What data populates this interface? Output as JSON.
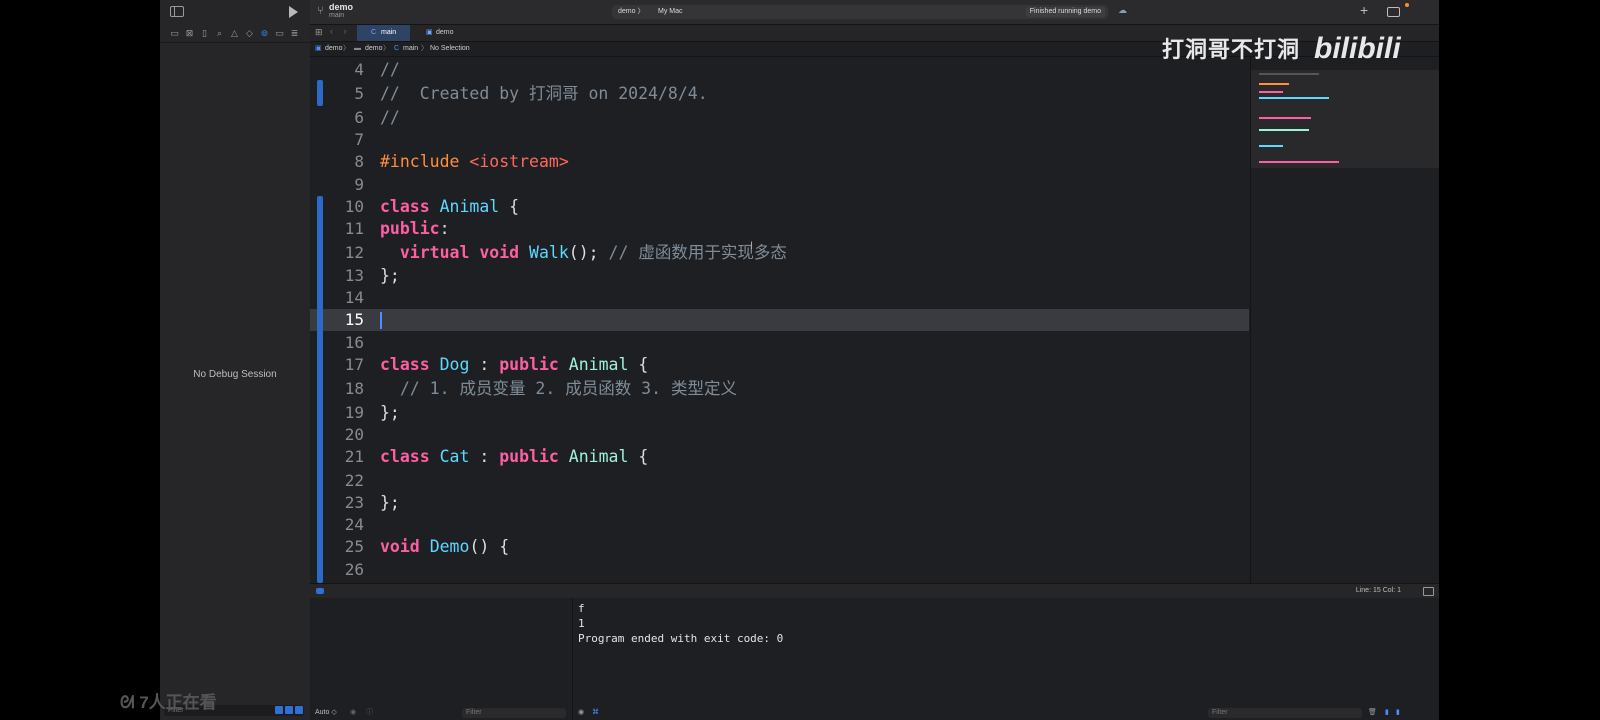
{
  "toolbar": {
    "project_name": "demo",
    "branch": "main",
    "scheme_target": "demo 〉",
    "run_destination": "My Mac",
    "status": "Finished running demo",
    "add_label": "+"
  },
  "tabs": [
    {
      "label": "main",
      "active": true
    },
    {
      "label": "demo",
      "active": false
    }
  ],
  "jumpbar": {
    "project": "demo",
    "folder": "demo",
    "file": "main",
    "selection": "No Selection",
    "separator": "〉"
  },
  "navigator": {
    "no_debug": "No Debug Session",
    "filter_placeholder": "Filter"
  },
  "editor": {
    "current_line": 15,
    "line_numbers": [
      "4",
      "5",
      "6",
      "7",
      "8",
      "9",
      "10",
      "11",
      "12",
      "13",
      "14",
      "15",
      "16",
      "17",
      "18",
      "19",
      "20",
      "21",
      "22",
      "23",
      "24",
      "25",
      "26"
    ],
    "code": {
      "l4_comment": "//",
      "l5_comment": "//  Created by 打洞哥 on 2024/8/4.",
      "l6_comment": "//",
      "l8_directive": "#include",
      "l8_header": "<iostream>",
      "l10_kw": "class",
      "l10_name": "Animal",
      "l10_rest": " {",
      "l11_kw": "public",
      "l11_rest": ":",
      "l12_kw1": "virtual",
      "l12_kw2": "void",
      "l12_fn": "Walk",
      "l12_rest": "(); ",
      "l12_comment": "// 虚函数用于实现多态",
      "l13": "};",
      "l17_kw1": "class",
      "l17_name": "Dog",
      "l17_colon": " : ",
      "l17_kw2": "public",
      "l17_base": "Animal",
      "l17_rest": " {",
      "l18_comment": "// 1. 成员变量 2. 成员函数 3. 类型定义",
      "l19": "};",
      "l21_kw1": "class",
      "l21_name": "Cat",
      "l21_colon": " : ",
      "l21_kw2": "public",
      "l21_base": "Animal",
      "l21_rest": " {",
      "l23": "};",
      "l25_kw": "void",
      "l25_fn": "Demo",
      "l25_rest": "() {"
    }
  },
  "watermark": {
    "uploader": "打洞哥不打洞",
    "brand": "bilibili"
  },
  "statusbar": {
    "position": "Line: 15  Col: 1"
  },
  "debug": {
    "scope": "Auto ◇",
    "variables_filter": "Filter",
    "console_filter": "Filter",
    "console_output": [
      "f",
      "1",
      "Program ended with exit code: 0"
    ]
  },
  "overlay": {
    "viewers": "7人正在看"
  },
  "colors": {
    "keyword": "#fc5fa3",
    "type_decl": "#5dd8ff",
    "type_ref": "#9ef1dd",
    "comment": "#7f8c98",
    "preprocessor": "#fd8f3f",
    "string": "#fc6a5d",
    "accent": "#2f6fd6"
  }
}
